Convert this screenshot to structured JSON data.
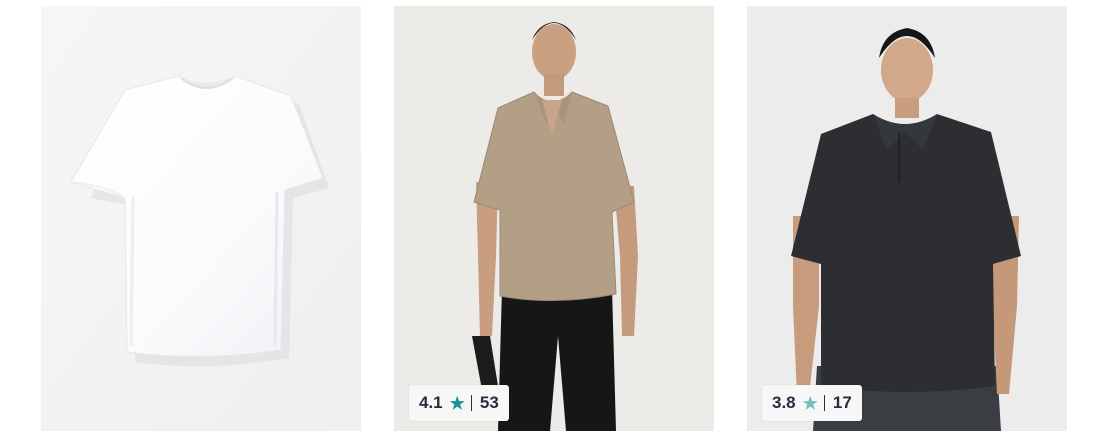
{
  "colors": {
    "rating_star_high": "#14958f",
    "rating_star_mid": "#72bfbc",
    "badge_text": "#282c3f",
    "badge_bg": "#f7f7f7"
  },
  "products": [
    {
      "image": "white-crew-neck-tshirt",
      "rating": null,
      "rating_count": null
    },
    {
      "image": "beige-knit-polo-model",
      "rating": "4.1",
      "star_icon": "star-icon",
      "rating_count": "53"
    },
    {
      "image": "black-polo-model",
      "rating": "3.8",
      "star_icon": "star-icon",
      "rating_count": "17"
    }
  ]
}
